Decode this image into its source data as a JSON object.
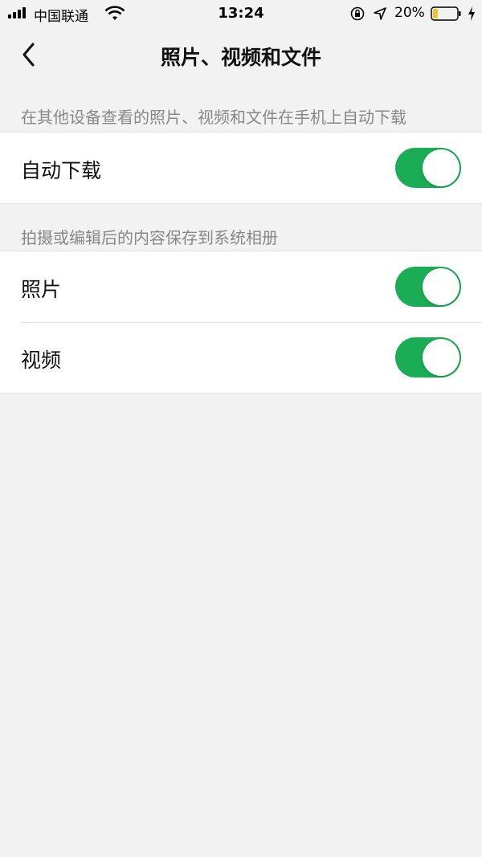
{
  "status_bar": {
    "carrier": "中国联通",
    "time": "13:24",
    "battery_percent": "20%",
    "icons": [
      "signal-icon",
      "wifi-icon",
      "rotation-lock-icon",
      "location-icon",
      "battery-icon",
      "charging-icon"
    ]
  },
  "nav": {
    "title": "照片、视频和文件",
    "back_icon": "chevron-left-icon"
  },
  "sections": {
    "sync": {
      "hint": "在其他设备查看的照片、视频和文件在手机上自动下载",
      "rows": [
        {
          "label": "自动下载",
          "enabled": true
        }
      ]
    },
    "save": {
      "hint": "拍摄或编辑后的内容保存到系统相册",
      "rows": [
        {
          "label": "照片",
          "enabled": true
        },
        {
          "label": "视频",
          "enabled": true
        }
      ]
    }
  },
  "colors": {
    "toggle_on": "#1aad55",
    "background": "#f2f2f2",
    "hint_text": "#888888"
  }
}
